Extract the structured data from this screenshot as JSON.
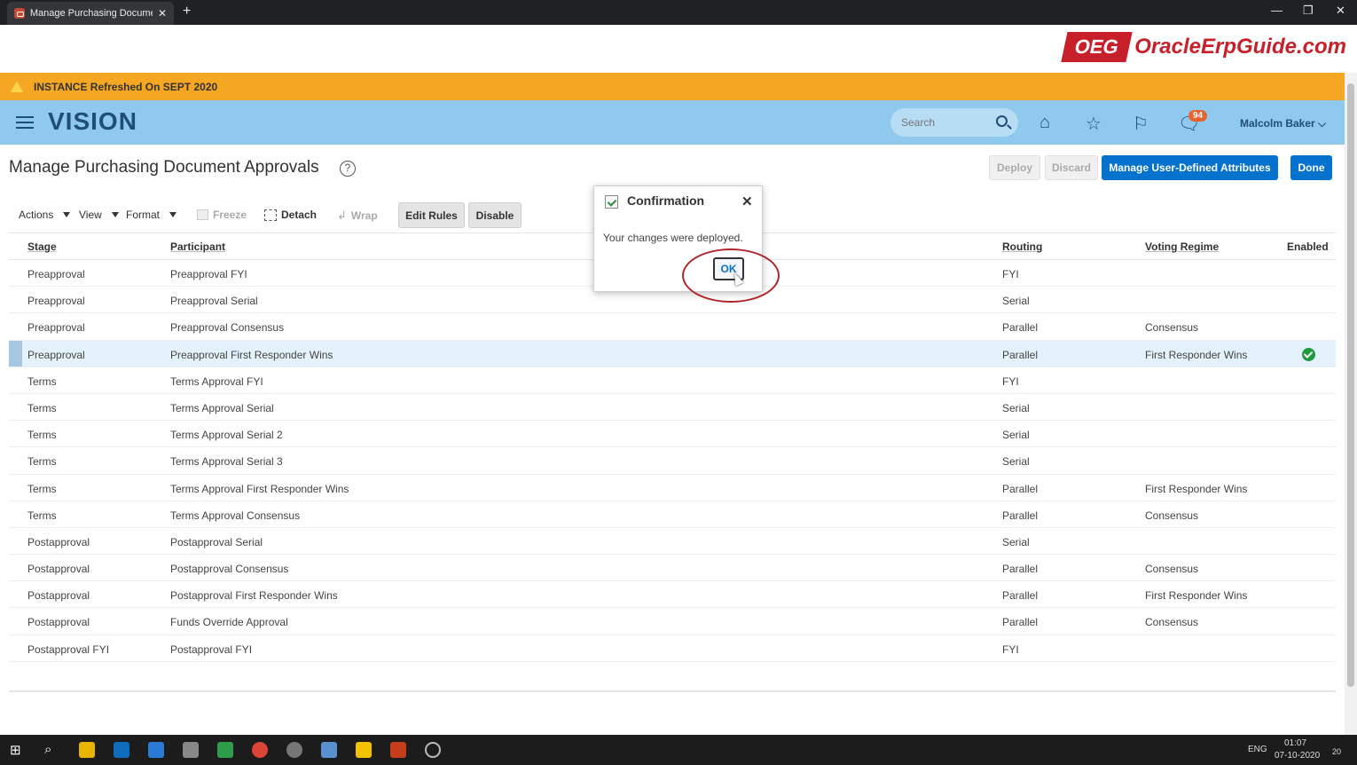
{
  "browser": {
    "tab_title": "Manage Purchasing Document A",
    "tab_close": "✕",
    "new_tab": "+",
    "minimize": "—",
    "restore": "❐",
    "close": "✕"
  },
  "banner_logo": {
    "badge": "OEG",
    "text": "OracleErpGuide.com"
  },
  "instance_banner": {
    "text": "INSTANCE Refreshed On SEPT 2020",
    "icon": "warning-icon"
  },
  "header": {
    "logo": "VISION",
    "search_placeholder": "Search",
    "notifications_count": "94",
    "user_name": "Malcolm Baker",
    "user_caret": "⌵",
    "icons": [
      "home-icon",
      "favorites-icon",
      "flag-icon",
      "notifications-icon"
    ]
  },
  "page": {
    "title": "Manage Purchasing Document Approvals",
    "help": "?",
    "buttons": {
      "deploy": "Deploy",
      "discard": "Discard",
      "manage_attributes": "Manage User-Defined Attributes",
      "done": "Done"
    }
  },
  "toolbar": {
    "actions": "Actions",
    "view": "View",
    "format": "Format",
    "freeze": "Freeze",
    "detach": "Detach",
    "wrap": "Wrap",
    "edit_rules": "Edit Rules",
    "disable": "Disable"
  },
  "table": {
    "headers": {
      "stage": "Stage",
      "participant": "Participant",
      "routing": "Routing",
      "voting_regime": "Voting Regime",
      "enabled": "Enabled"
    },
    "rows": [
      {
        "stage": "Preapproval",
        "participant": "Preapproval FYI",
        "routing": "FYI",
        "voting": "",
        "enabled": false
      },
      {
        "stage": "Preapproval",
        "participant": "Preapproval Serial",
        "routing": "Serial",
        "voting": "",
        "enabled": false
      },
      {
        "stage": "Preapproval",
        "participant": "Preapproval Consensus",
        "routing": "Parallel",
        "voting": "Consensus",
        "enabled": false
      },
      {
        "stage": "Preapproval",
        "participant": "Preapproval First Responder Wins",
        "routing": "Parallel",
        "voting": "First Responder Wins",
        "enabled": true
      },
      {
        "stage": "Terms",
        "participant": "Terms Approval FYI",
        "routing": "FYI",
        "voting": "",
        "enabled": false
      },
      {
        "stage": "Terms",
        "participant": "Terms Approval Serial",
        "routing": "Serial",
        "voting": "",
        "enabled": false
      },
      {
        "stage": "Terms",
        "participant": "Terms Approval Serial 2",
        "routing": "Serial",
        "voting": "",
        "enabled": false
      },
      {
        "stage": "Terms",
        "participant": "Terms Approval Serial 3",
        "routing": "Serial",
        "voting": "",
        "enabled": false
      },
      {
        "stage": "Terms",
        "participant": "Terms Approval First Responder Wins",
        "routing": "Parallel",
        "voting": "First Responder Wins",
        "enabled": false
      },
      {
        "stage": "Terms",
        "participant": "Terms Approval Consensus",
        "routing": "Parallel",
        "voting": "Consensus",
        "enabled": false
      },
      {
        "stage": "Postapproval",
        "participant": "Postapproval Serial",
        "routing": "Serial",
        "voting": "",
        "enabled": false
      },
      {
        "stage": "Postapproval",
        "participant": "Postapproval Consensus",
        "routing": "Parallel",
        "voting": "Consensus",
        "enabled": false
      },
      {
        "stage": "Postapproval",
        "participant": "Postapproval First Responder Wins",
        "routing": "Parallel",
        "voting": "First Responder Wins",
        "enabled": false
      },
      {
        "stage": "Postapproval",
        "participant": "Funds Override Approval",
        "routing": "Parallel",
        "voting": "Consensus",
        "enabled": false
      },
      {
        "stage": "Postapproval FYI",
        "participant": "Postapproval FYI",
        "routing": "FYI",
        "voting": "",
        "enabled": false
      }
    ],
    "selected_row": 3
  },
  "dialog": {
    "title": "Confirmation",
    "message": "Your changes were deployed.",
    "ok": "OK",
    "close": "✕"
  },
  "taskbar": {
    "language": "ENG",
    "time": "01:07",
    "date": "07-10-2020",
    "notification_count": "20"
  },
  "colors": {
    "header_bg": "#8fc9ed",
    "banner_bg": "#f5a623",
    "primary": "#0572ce",
    "annotation": "#b0262c"
  }
}
